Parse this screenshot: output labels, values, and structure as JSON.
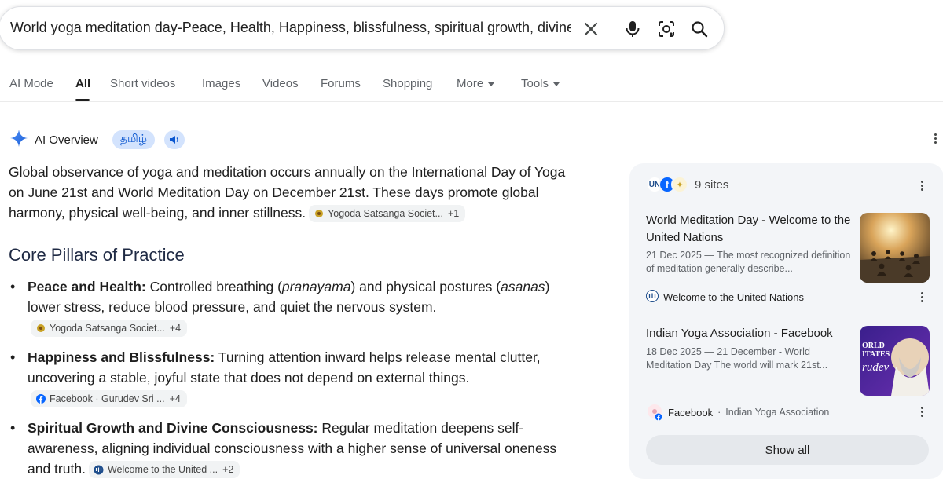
{
  "search": {
    "query": "World yoga meditation day-Peace, Health, Happiness, blissfulness, spiritual growth, divine c"
  },
  "tabs": [
    {
      "label": "AI Mode"
    },
    {
      "label": "All"
    },
    {
      "label": "Short videos"
    },
    {
      "label": "Images"
    },
    {
      "label": "Videos"
    },
    {
      "label": "Forums"
    },
    {
      "label": "Shopping"
    },
    {
      "label": "More"
    },
    {
      "label": "Tools"
    }
  ],
  "overview": {
    "title": "AI Overview",
    "language_chip": "தமிழ்",
    "intro": "Global observance of yoga and meditation occurs annually on the International Day of Yoga on June 21st and World Meditation Day on December 21st. These days promote global harmony, physical well-being, and inner stillness.",
    "intro_cite": {
      "source": "Yogoda Satsanga Societ...",
      "more": "+1"
    },
    "section_title": "Core Pillars of Practice",
    "bullets": [
      {
        "heading": "Peace and Health:",
        "text_a": " Controlled breathing (",
        "em_a": "pranayama",
        "text_b": ") and physical postures (",
        "em_b": "asanas",
        "text_c": ") lower stress, reduce blood pressure, and quiet the nervous system.",
        "cite": {
          "source": "Yogoda Satsanga Societ...",
          "more": "+4"
        }
      },
      {
        "heading": "Happiness and Blissfulness:",
        "text": " Turning attention inward helps release mental clutter, uncovering a stable, joyful state that does not depend on external things.",
        "cite": {
          "source": "Facebook · Gurudev Sri ...",
          "more": "+4"
        }
      },
      {
        "heading": "Spiritual Growth and Divine Consciousness:",
        "text": " Regular meditation deepens self-awareness, aligning individual consciousness with a higher sense of universal oneness and truth.",
        "cite": {
          "source": "Welcome to the United ...",
          "more": "+2"
        }
      }
    ]
  },
  "sources_panel": {
    "count_label": "9 sites",
    "sources": [
      {
        "title": "World Meditation Day - Welcome to the United Nations",
        "snippet": "21 Dec 2025 — The most recognized definition of meditation generally describe...",
        "site": "Welcome to the United Nations",
        "site_sub": ""
      },
      {
        "title": "Indian Yoga Association - Facebook",
        "snippet": "18 Dec 2025 — 21 December - World Meditation Day The world will mark 21st...",
        "site": "Facebook",
        "site_sub": "Indian Yoga Association",
        "thumb_text": "ORLD ITATES rudev"
      }
    ],
    "show_all": "Show all"
  },
  "colors": {
    "accent_blue": "#0b57d0",
    "chip_blue": "#d3e3fd",
    "panel_bg": "#f3f5f8"
  },
  "icons": [
    "close-icon",
    "mic-icon",
    "lens-icon",
    "search-icon",
    "sparkle-icon",
    "speaker-icon",
    "more-vert-icon",
    "un-logo-icon",
    "facebook-icon"
  ]
}
